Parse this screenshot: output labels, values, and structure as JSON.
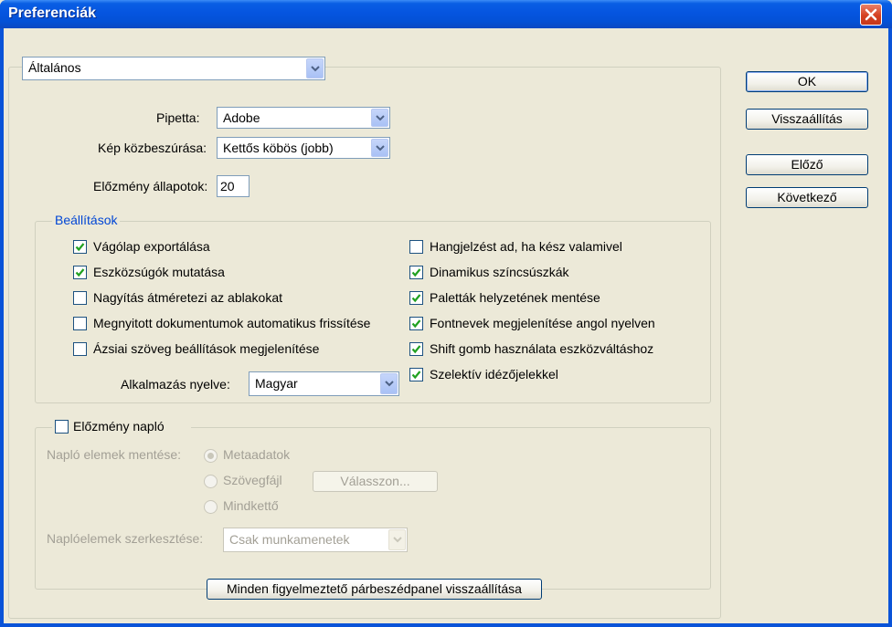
{
  "window": {
    "title": "Preferenciák"
  },
  "category": {
    "selected": "Általános"
  },
  "fields": {
    "pipetta_label": "Pipetta:",
    "pipetta_value": "Adobe",
    "interp_label": "Kép közbeszúrása:",
    "interp_value": "Kettős köbös (jobb)",
    "history_label": "Előzmény állapotok:",
    "history_value": "20"
  },
  "options": {
    "title": "Beállítások",
    "left": [
      {
        "label": "Vágólap exportálása",
        "checked": true
      },
      {
        "label": "Eszközsúgók mutatása",
        "checked": true
      },
      {
        "label": "Nagyítás átméretezi az ablakokat",
        "checked": false
      },
      {
        "label": "Megnyitott dokumentumok automatikus frissítése",
        "checked": false
      },
      {
        "label": "Ázsiai szöveg beállítások megjelenítése",
        "checked": false
      }
    ],
    "right": [
      {
        "label": "Hangjelzést ad, ha kész valamivel",
        "checked": false
      },
      {
        "label": "Dinamikus színcsúszkák",
        "checked": true
      },
      {
        "label": "Paletták helyzetének mentése",
        "checked": true
      },
      {
        "label": "Fontnevek megjelenítése angol nyelven",
        "checked": true
      },
      {
        "label": "Shift gomb használata eszközváltáshoz",
        "checked": true
      },
      {
        "label": "Szelektív idézőjelekkel",
        "checked": true
      }
    ],
    "lang_label": "Alkalmazás nyelve:",
    "lang_value": "Magyar"
  },
  "history_log": {
    "title": "Előzmény napló",
    "checked": false,
    "save_label": "Napló elemek mentése:",
    "radio_metadata": "Metaadatok",
    "radio_textfile": "Szövegfájl",
    "radio_both": "Mindkettő",
    "choose_button": "Válasszon...",
    "edit_label": "Naplóelemek szerkesztése:",
    "edit_value": "Csak munkamenetek"
  },
  "buttons": {
    "ok": "OK",
    "reset": "Visszaállítás",
    "prev": "Előző",
    "next": "Következő",
    "reset_warnings": "Minden figyelmeztető párbeszédpanel visszaállítása"
  }
}
